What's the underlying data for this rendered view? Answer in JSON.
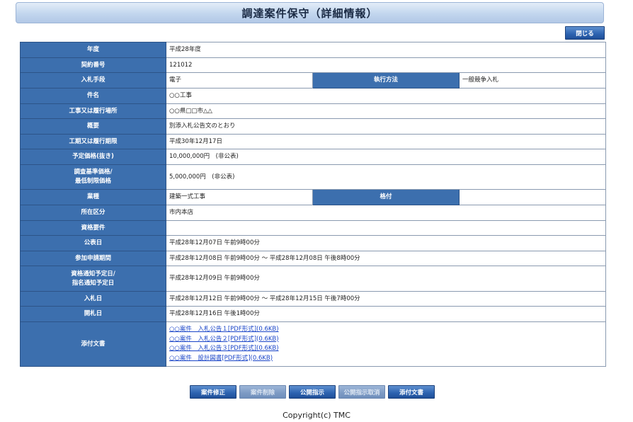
{
  "header": {
    "title": "調達案件保守（詳細情報）"
  },
  "toolbar": {
    "close_label": "閉じる"
  },
  "fields": {
    "year": {
      "label": "年度",
      "value": "平成28年度"
    },
    "contract_no": {
      "label": "契約番号",
      "value": "121012"
    },
    "bid_method": {
      "label": "入札手段",
      "value": "電子"
    },
    "exec_method": {
      "label": "執行方法",
      "value": "一般競争入札"
    },
    "case_name": {
      "label": "件名",
      "value": "○○工事"
    },
    "location": {
      "label": "工事又は履行場所",
      "value": "○○県□□市△△"
    },
    "summary": {
      "label": "概要",
      "value": "別添入札公告文のとおり"
    },
    "deadline": {
      "label": "工期又は履行期限",
      "value": "平成30年12月17日"
    },
    "estimate": {
      "label": "予定価格(抜き)",
      "value": "10,000,000円　(非公表)"
    },
    "base_price": {
      "label_line1": "調査基準価格/",
      "label_line2": "最低制限価格",
      "value": "5,000,000円　(非公表)"
    },
    "industry": {
      "label": "業種",
      "value": "建築一式工事"
    },
    "rating": {
      "label": "格付",
      "value": ""
    },
    "area": {
      "label": "所在区分",
      "value": "市内本店"
    },
    "qualification": {
      "label": "資格要件",
      "value": ""
    },
    "publish_date": {
      "label": "公表日",
      "value": "平成28年12月07日 午前9時00分"
    },
    "apply_period": {
      "label": "参加申請期間",
      "value": "平成28年12月08日 午前9時00分 ～ 平成28年12月08日 午後8時00分"
    },
    "notice_date": {
      "label_line1": "資格通知予定日/",
      "label_line2": "指名通知予定日",
      "value": "平成28年12月09日 午前9時00分"
    },
    "bid_date": {
      "label": "入札日",
      "value": "平成28年12月12日 午前9時00分 ～ 平成28年12月15日 午後7時00分"
    },
    "open_date": {
      "label": "開札日",
      "value": "平成28年12月16日 午後1時00分"
    },
    "attachments": {
      "label": "添付文書",
      "files": [
        "○○案件　入札公告１[PDF形式](0.6KB)",
        "○○案件　入札公告２[PDF形式](0.6KB)",
        "○○案件　入札公告３[PDF形式](0.6KB)",
        "○○案件　設計図書[PDF形式](0.6KB)"
      ]
    }
  },
  "footer": {
    "buttons": {
      "edit": "案件修正",
      "delete": "案件削除",
      "publish": "公開指示",
      "unpublish": "公開指示取消",
      "attach": "添付文書"
    },
    "copyright": "Copyright(c) TMC"
  }
}
